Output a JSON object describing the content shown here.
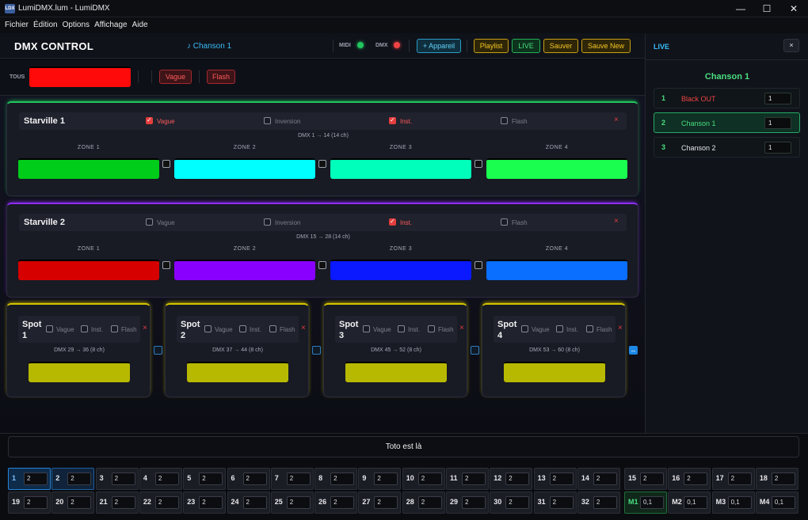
{
  "window": {
    "title": "LumiDMX.lum - LumiDMX",
    "icon_text": "LDX",
    "minimize": "—",
    "maximize": "☐",
    "close": "✕"
  },
  "menu": [
    "Fichier",
    "Édition",
    "Options",
    "Affichage",
    "Aide"
  ],
  "header": {
    "app_name": "DMX CONTROL",
    "song": "♪ Chanson 1",
    "midi_label": "MIDI",
    "dmx_label": "DMX",
    "midi_color": "#22c55e",
    "dmx_color": "#ef4444",
    "buttons": {
      "add_device": "+ Appareil",
      "playlist": "Playlist",
      "live": "LIVE",
      "save": "Sauver",
      "save_new": "Sauve New"
    }
  },
  "tous": {
    "label": "TOUS",
    "color": "#ff0a0a",
    "wave": "Vague",
    "flash": "Flash"
  },
  "fixtures": [
    {
      "name": "Starville 1",
      "accent": "#22c55e",
      "options": [
        {
          "label": "Vague",
          "checked": true
        },
        {
          "label": "Inversion",
          "checked": false
        },
        {
          "label": "Inst.",
          "checked": true
        },
        {
          "label": "Flash",
          "checked": false
        }
      ],
      "range": "DMX 1 → 14 (14 ch)",
      "zones": [
        {
          "label": "ZONE 1",
          "color": "#00cc1a"
        },
        {
          "label": "ZONE 2",
          "color": "#00ffff"
        },
        {
          "label": "ZONE 3",
          "color": "#00ffbb"
        },
        {
          "label": "ZONE 4",
          "color": "#1aff4f"
        }
      ]
    },
    {
      "name": "Starville 2",
      "accent": "#8b2cf5",
      "options": [
        {
          "label": "Vague",
          "checked": false
        },
        {
          "label": "Inversion",
          "checked": false
        },
        {
          "label": "Inst.",
          "checked": true
        },
        {
          "label": "Flash",
          "checked": false
        }
      ],
      "range": "DMX 15 → 28 (14 ch)",
      "zones": [
        {
          "label": "ZONE 1",
          "color": "#d60000"
        },
        {
          "label": "ZONE 2",
          "color": "#8a00ff"
        },
        {
          "label": "ZONE 3",
          "color": "#0a19ff"
        },
        {
          "label": "ZONE 4",
          "color": "#0a6eff"
        }
      ]
    }
  ],
  "spots": [
    {
      "name": "Spot 1",
      "range": "DMX 29 → 36 (8 ch)",
      "color": "#b7b900"
    },
    {
      "name": "Spot 2",
      "range": "DMX 37 → 44 (8 ch)",
      "color": "#b7b900"
    },
    {
      "name": "Spot 3",
      "range": "DMX 45 → 52 (8 ch)",
      "color": "#b7b900"
    },
    {
      "name": "Spot 4",
      "range": "DMX 53 → 60 (8 ch)",
      "color": "#b7b900"
    }
  ],
  "spot_options": [
    "Vague",
    "Inst.",
    "Flash"
  ],
  "spot_accent": "#d4c400",
  "link_icon": "↔",
  "close_x": "×",
  "sidebar": {
    "title": "LIVE",
    "close": "×",
    "song": "Chanson 1",
    "cues": [
      {
        "n": "1",
        "label": "Black OUT",
        "value": "1",
        "label_color": "#ef4444"
      },
      {
        "n": "2",
        "label": "Chanson 1",
        "value": "1",
        "label_color": "#4ade80"
      },
      {
        "n": "3",
        "label": "Chanson 2",
        "value": "1",
        "label_color": "#e5e7eb"
      }
    ]
  },
  "bottom": {
    "song_text": "Toto est là",
    "row1": [
      {
        "n": "1",
        "v": "2"
      },
      {
        "n": "2",
        "v": "2"
      },
      {
        "n": "3",
        "v": "2"
      },
      {
        "n": "4",
        "v": "2"
      },
      {
        "n": "5",
        "v": "2"
      },
      {
        "n": "6",
        "v": "2"
      },
      {
        "n": "7",
        "v": "2"
      },
      {
        "n": "8",
        "v": "2"
      },
      {
        "n": "9",
        "v": "2"
      },
      {
        "n": "10",
        "v": "2"
      },
      {
        "n": "11",
        "v": "2"
      },
      {
        "n": "12",
        "v": "2"
      },
      {
        "n": "13",
        "v": "2"
      },
      {
        "n": "14",
        "v": "2"
      },
      {
        "n": "15",
        "v": "2"
      },
      {
        "n": "16",
        "v": "2"
      },
      {
        "n": "17",
        "v": "2"
      },
      {
        "n": "18",
        "v": "2"
      }
    ],
    "row2": [
      {
        "n": "19",
        "v": "2"
      },
      {
        "n": "20",
        "v": "2"
      },
      {
        "n": "21",
        "v": "2"
      },
      {
        "n": "22",
        "v": "2"
      },
      {
        "n": "23",
        "v": "2"
      },
      {
        "n": "24",
        "v": "2"
      },
      {
        "n": "25",
        "v": "2"
      },
      {
        "n": "26",
        "v": "2"
      },
      {
        "n": "27",
        "v": "2"
      },
      {
        "n": "28",
        "v": "2"
      },
      {
        "n": "29",
        "v": "2"
      },
      {
        "n": "30",
        "v": "2"
      },
      {
        "n": "31",
        "v": "2"
      },
      {
        "n": "32",
        "v": "2"
      },
      {
        "n": "M1",
        "v": "0,1"
      },
      {
        "n": "M2",
        "v": "0,1"
      },
      {
        "n": "M3",
        "v": "0,1"
      },
      {
        "n": "M4",
        "v": "0,1"
      }
    ]
  }
}
